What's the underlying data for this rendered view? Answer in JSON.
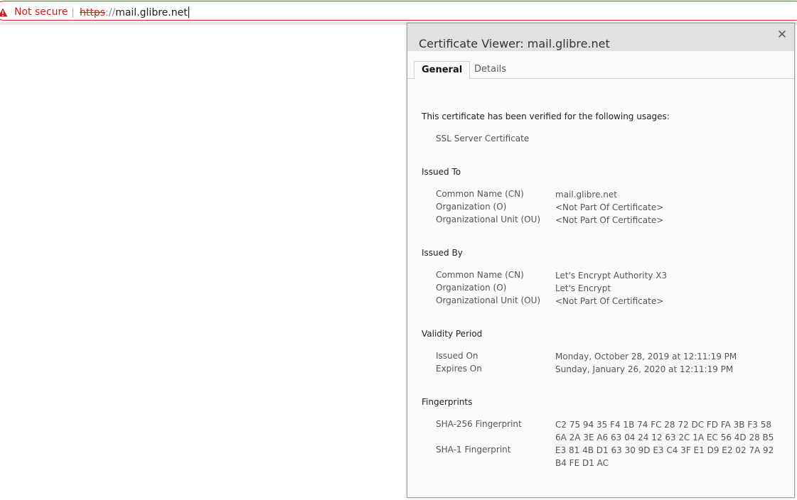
{
  "omnibox": {
    "security_icon": "warning-triangle-icon",
    "security_label": "Not secure",
    "url_scheme": "https",
    "url_separator": "://",
    "url_host": "mail.glibre.net",
    "accent_color": "#d93025"
  },
  "dialog": {
    "title": "Certificate Viewer: mail.glibre.net",
    "close_glyph": "✕",
    "tabs": [
      {
        "label": "General",
        "selected": true
      },
      {
        "label": "Details",
        "selected": false
      }
    ],
    "usages_title": "This certificate has been verified for the following usages:",
    "usages": [
      "SSL Server Certificate"
    ],
    "issued_to": {
      "title": "Issued To",
      "rows": [
        {
          "label": "Common Name (CN)",
          "value": "mail.glibre.net"
        },
        {
          "label": "Organization (O)",
          "value": "<Not Part Of Certificate>"
        },
        {
          "label": "Organizational Unit (OU)",
          "value": "<Not Part Of Certificate>"
        }
      ]
    },
    "issued_by": {
      "title": "Issued By",
      "rows": [
        {
          "label": "Common Name (CN)",
          "value": "Let's Encrypt Authority X3"
        },
        {
          "label": "Organization (O)",
          "value": "Let's Encrypt"
        },
        {
          "label": "Organizational Unit (OU)",
          "value": "<Not Part Of Certificate>"
        }
      ]
    },
    "validity": {
      "title": "Validity Period",
      "rows": [
        {
          "label": "Issued On",
          "value": "Monday, October 28, 2019 at 12:11:19 PM"
        },
        {
          "label": "Expires On",
          "value": "Sunday, January 26, 2020 at 12:11:19 PM"
        }
      ]
    },
    "fingerprints": {
      "title": "Fingerprints",
      "rows": [
        {
          "label": "SHA-256 Fingerprint",
          "value_line1": "C2 75 94 35 F4 1B 74 FC 28 72 DC FD FA 3B F3 58",
          "value_line2": "6A 2A 3E A6 63 04 24 12 63 2C 1A EC 56 4D 28 B5"
        },
        {
          "label": "SHA-1 Fingerprint",
          "value_line1": "E3 81 4B D1 63 30 9D E3 C4 3F E1 D9 E2 02 7A 92",
          "value_line2": "B4 FE D1 AC"
        }
      ]
    }
  }
}
